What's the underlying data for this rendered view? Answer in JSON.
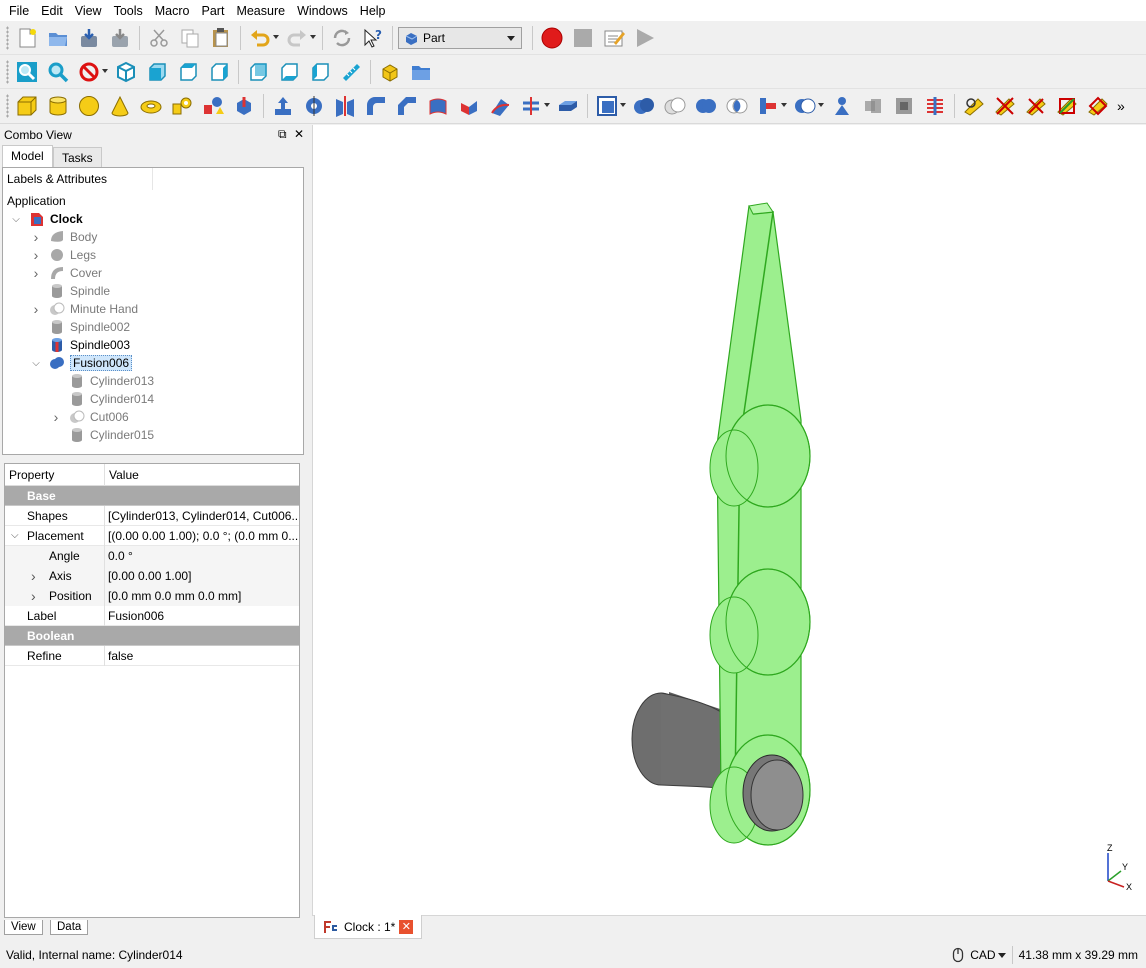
{
  "menu": [
    "File",
    "Edit",
    "View",
    "Tools",
    "Macro",
    "Part",
    "Measure",
    "Windows",
    "Help"
  ],
  "workbench": {
    "selected": "Part"
  },
  "combo": {
    "title": "Combo View",
    "tabs": [
      "Model",
      "Tasks"
    ]
  },
  "tree": {
    "header": "Labels & Attributes",
    "section": "Application",
    "items": [
      {
        "label": "Clock",
        "state": "bold",
        "expander": "open",
        "icon": "document-icon"
      },
      {
        "label": "Body",
        "state": "gray",
        "expander": "closed",
        "icon": "body-icon"
      },
      {
        "label": "Legs",
        "state": "gray",
        "expander": "closed",
        "icon": "legs-icon"
      },
      {
        "label": "Cover",
        "state": "gray",
        "expander": "closed",
        "icon": "cover-icon"
      },
      {
        "label": "Spindle",
        "state": "gray",
        "expander": "none",
        "icon": "cylinder-icon"
      },
      {
        "label": "Minute Hand",
        "state": "gray",
        "expander": "closed",
        "icon": "cut-icon"
      },
      {
        "label": "Spindle002",
        "state": "gray",
        "expander": "none",
        "icon": "cylinder-icon"
      },
      {
        "label": "Spindle003",
        "state": "normal",
        "expander": "none",
        "icon": "cylinder-colored-icon"
      },
      {
        "label": "Fusion006",
        "state": "selected",
        "expander": "open",
        "icon": "fusion-icon"
      },
      {
        "label": "Cylinder013",
        "state": "gray",
        "expander": "none",
        "icon": "cylinder-icon"
      },
      {
        "label": "Cylinder014",
        "state": "gray",
        "expander": "none",
        "icon": "cylinder-icon"
      },
      {
        "label": "Cut006",
        "state": "gray",
        "expander": "closed",
        "icon": "cut-icon"
      },
      {
        "label": "Cylinder015",
        "state": "gray",
        "expander": "none",
        "icon": "cylinder-icon"
      }
    ]
  },
  "properties": {
    "col_property": "Property",
    "col_value": "Value",
    "rows": [
      {
        "type": "group",
        "label": "Base"
      },
      {
        "type": "prop",
        "key": "Shapes",
        "value": "[Cylinder013, Cylinder014, Cut006...",
        "level": 0,
        "expander": "none"
      },
      {
        "type": "prop",
        "key": "Placement",
        "value": "[(0.00 0.00 1.00); 0.0 °; (0.0 mm  0....",
        "level": 0,
        "expander": "open"
      },
      {
        "type": "prop",
        "key": "Angle",
        "value": "0.0 °",
        "level": 1,
        "expander": "none"
      },
      {
        "type": "prop",
        "key": "Axis",
        "value": "[0.00 0.00 1.00]",
        "level": 1,
        "expander": "closed"
      },
      {
        "type": "prop",
        "key": "Position",
        "value": "[0.0 mm  0.0 mm  0.0 mm]",
        "level": 1,
        "expander": "closed"
      },
      {
        "type": "prop",
        "key": "Label",
        "value": "Fusion006",
        "level": 0,
        "expander": "none"
      },
      {
        "type": "group",
        "label": "Boolean"
      },
      {
        "type": "prop",
        "key": "Refine",
        "value": "false",
        "level": 0,
        "expander": "none"
      }
    ]
  },
  "bottom_tabs": [
    "View",
    "Data"
  ],
  "document_tab": {
    "label": "Clock : 1*"
  },
  "axes": {
    "z": "Z",
    "y": "Y",
    "x": "X"
  },
  "status": {
    "message": "Valid, Internal name: Cylinder014",
    "nav_style": "CAD",
    "dimensions": "41.38 mm x 39.29 mm"
  },
  "colors": {
    "selection_green": "#9cef8e",
    "selection_edge": "#2fa81f",
    "tree_selection": "#cfe6fb",
    "record_red": "#e01b1b"
  }
}
